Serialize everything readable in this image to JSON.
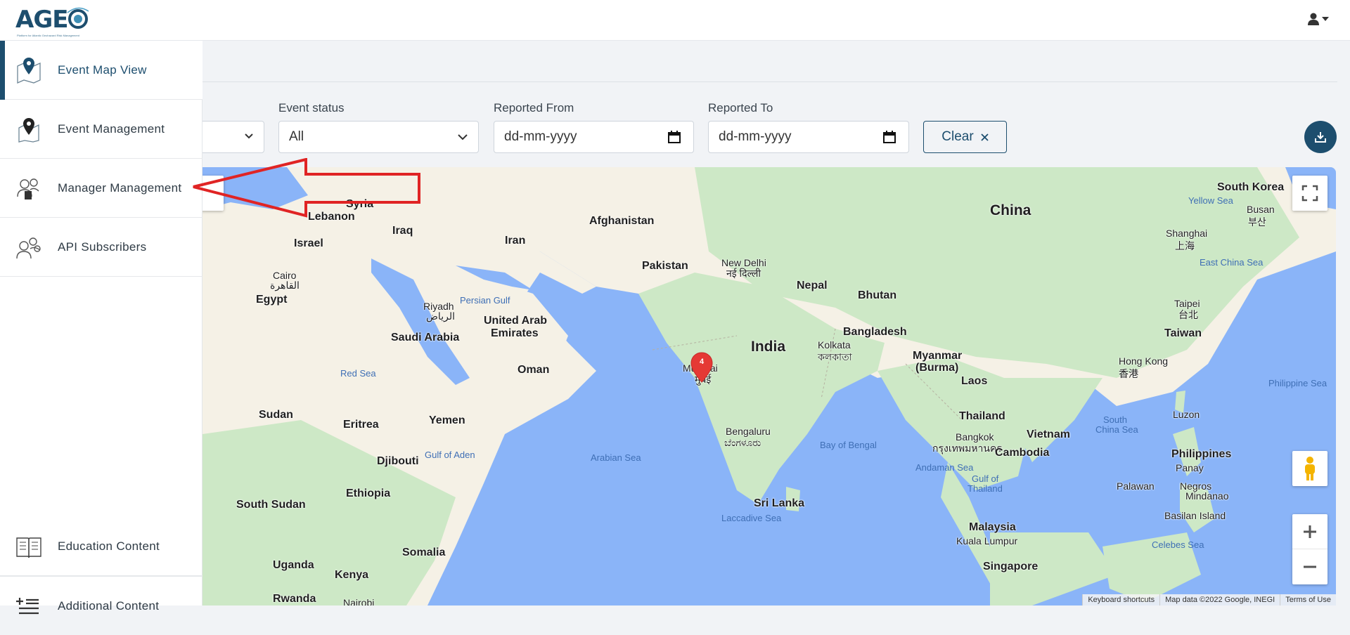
{
  "app": {
    "logo_text": "AGEO",
    "logo_tagline": "Platform for Atlantic Geohazard Risk Management"
  },
  "sidebar": {
    "items": [
      {
        "label": "Event Map View",
        "icon": "map-pin-icon",
        "active": true
      },
      {
        "label": "Event Management",
        "icon": "event-map-icon",
        "active": false
      },
      {
        "label": "Manager Management",
        "icon": "manager-users-icon",
        "active": false
      },
      {
        "label": "API Subscribers",
        "icon": "subscribers-icon",
        "active": false
      },
      {
        "label": "Education Content",
        "icon": "book-icon",
        "active": false
      },
      {
        "label": "Additional Content",
        "icon": "add-list-icon",
        "active": false
      }
    ]
  },
  "filters": {
    "event_status": {
      "label": "Event status",
      "value": "All"
    },
    "reported_from": {
      "label": "Reported From",
      "placeholder": "dd-mm-yyyy"
    },
    "reported_to": {
      "label": "Reported To",
      "placeholder": "dd-mm-yyyy"
    },
    "clear_label": "Clear"
  },
  "map": {
    "marker_count": "4",
    "labels": {
      "china": "China",
      "south_korea": "South Korea",
      "yellow_sea": "Yellow Sea",
      "busan": "Busan",
      "busan_local": "부산",
      "shanghai": "Shanghai",
      "shanghai_local": "上海",
      "east_china_sea": "East China Sea",
      "taipei": "Taipei",
      "taipei_local": "台北",
      "taiwan": "Taiwan",
      "hong_kong": "Hong Kong",
      "hong_kong_local": "香港",
      "philippine_sea": "Philippine Sea",
      "afghanistan": "Afghanistan",
      "pakistan": "Pakistan",
      "new_delhi": "New Delhi",
      "new_delhi_local": "नई दिल्ली",
      "nepal": "Nepal",
      "bhutan": "Bhutan",
      "bangladesh": "Bangladesh",
      "kolkata": "Kolkata",
      "kolkata_local": "কলকাতা",
      "india": "India",
      "myanmar": "Myanmar",
      "burma": "(Burma)",
      "laos": "Laos",
      "thailand": "Thailand",
      "bangkok": "Bangkok",
      "bangkok_local": "กรุงเทพมหานคร",
      "cambodia": "Cambodia",
      "vietnam": "Vietnam",
      "south_china_sea_1": "South",
      "south_china_sea_2": "China Sea",
      "luzon": "Luzon",
      "philippines": "Philippines",
      "panay": "Panay",
      "negros": "Negros",
      "mindanao": "Mindanao",
      "palawan": "Palawan",
      "basilan": "Basilan Island",
      "celebes_sea": "Celebes Sea",
      "andaman_sea": "Andaman Sea",
      "gulf_thailand_1": "Gulf of",
      "gulf_thailand_2": "Thailand",
      "bay_of_bengal": "Bay of Bengal",
      "bengaluru": "Bengaluru",
      "bengaluru_local": "ಬೆಂಗಳೂರು",
      "sri_lanka": "Sri Lanka",
      "laccadive_sea": "Laccadive Sea",
      "malaysia": "Malaysia",
      "kuala_lumpur": "Kuala Lumpur",
      "singapore": "Singapore",
      "mumbai": "Mumbai",
      "mumbai_local": "मुंबई",
      "arabian_sea": "Arabian Sea",
      "syria": "Syria",
      "lebanon": "Lebanon",
      "iraq": "Iraq",
      "iran": "Iran",
      "israel": "Israel",
      "cairo": "Cairo",
      "cairo_local": "القاهرة",
      "egypt": "Egypt",
      "riyadh": "Riyadh",
      "riyadh_local": "الرياض",
      "persian_gulf": "Persian Gulf",
      "uae_1": "United Arab",
      "uae_2": "Emirates",
      "saudi": "Saudi Arabia",
      "oman": "Oman",
      "red_sea": "Red Sea",
      "sudan": "Sudan",
      "eritrea": "Eritrea",
      "yemen": "Yemen",
      "gulf_aden": "Gulf of Aden",
      "djibouti": "Djibouti",
      "ethiopia": "Ethiopia",
      "south_sudan": "South Sudan",
      "somalia": "Somalia",
      "uganda": "Uganda",
      "kenya": "Kenya",
      "nairobi": "Nairobi",
      "rwanda": "Rwanda"
    },
    "footer": {
      "shortcuts": "Keyboard shortcuts",
      "data": "Map data ©2022 Google, INEGI",
      "terms": "Terms of Use"
    }
  },
  "colors": {
    "brand": "#1d4e6e",
    "annotation_arrow": "#e02424",
    "marker": "#e53935",
    "water": "#8ab4f8",
    "land": "#f5f1e6",
    "green_land": "#cde8c6"
  }
}
